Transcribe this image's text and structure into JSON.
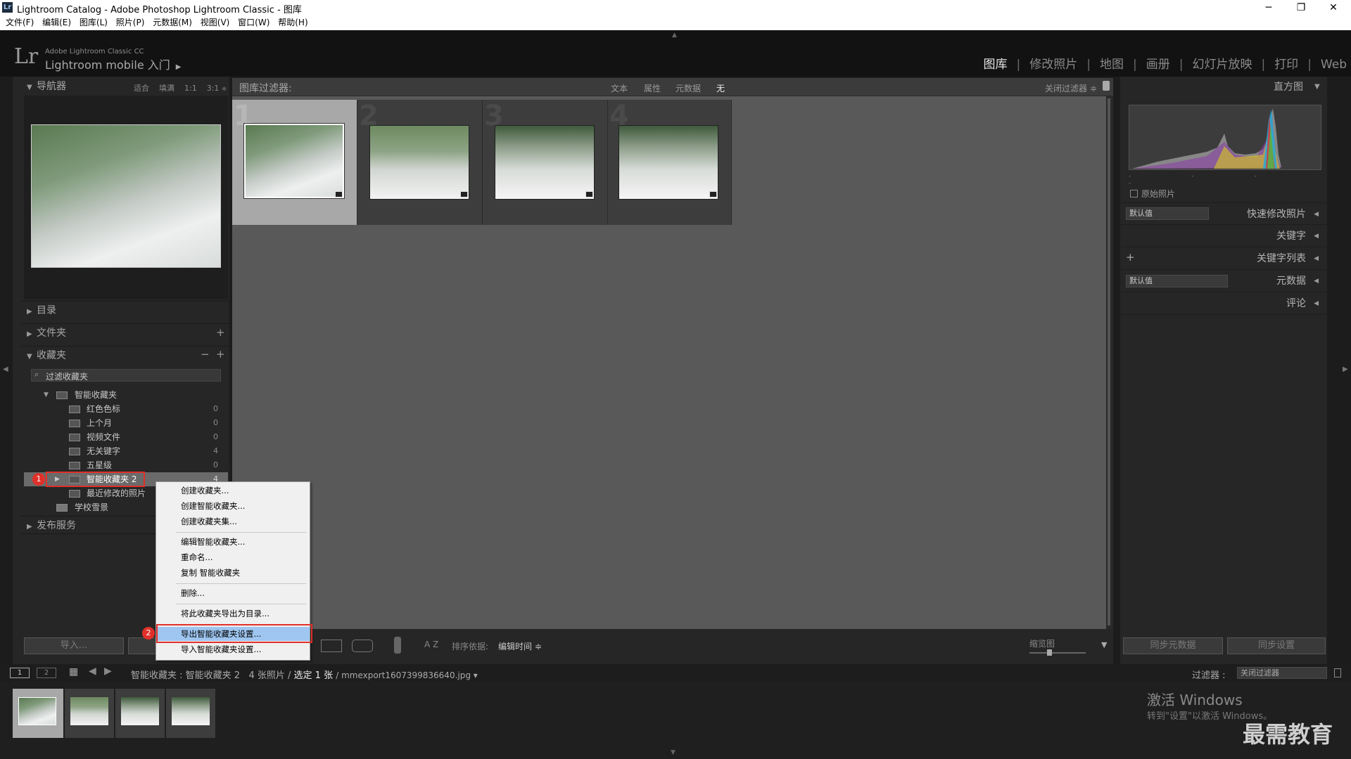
{
  "window": {
    "title": "Lightroom Catalog - Adobe Photoshop Lightroom Classic - 图库",
    "app_badge": "Lr",
    "buttons": {
      "minimize": "─",
      "maximize": "❐",
      "close": "✕"
    }
  },
  "menubar": [
    "文件(F)",
    "编辑(E)",
    "图库(L)",
    "照片(P)",
    "元数据(M)",
    "视图(V)",
    "窗口(W)",
    "帮助(H)"
  ],
  "brand": {
    "logo": "Lr",
    "line1": "Adobe Lightroom Classic CC",
    "line2": "Lightroom mobile 入门",
    "line2_arrow": "▶"
  },
  "modules": [
    {
      "label": "图库",
      "active": true
    },
    {
      "label": "修改照片",
      "active": false
    },
    {
      "label": "地图",
      "active": false
    },
    {
      "label": "画册",
      "active": false
    },
    {
      "label": "幻灯片放映",
      "active": false
    },
    {
      "label": "打印",
      "active": false
    },
    {
      "label": "Web",
      "active": false
    }
  ],
  "navigator": {
    "title": "导航器",
    "zoom_options": [
      "适合",
      "填满",
      "1:1",
      "3:1"
    ]
  },
  "left_panels": {
    "catalog": "目录",
    "folders": "文件夹",
    "folders_add": "+",
    "collections": "收藏夹",
    "collections_minus": "−",
    "collections_plus": "+",
    "filter_placeholder": "过滤收藏夹",
    "publish": "发布服务"
  },
  "collections": {
    "smart_set": "智能收藏夹",
    "items": [
      {
        "label": "红色色标",
        "count": "0"
      },
      {
        "label": "上个月",
        "count": "0"
      },
      {
        "label": "视频文件",
        "count": "0"
      },
      {
        "label": "无关键字",
        "count": "4"
      },
      {
        "label": "五星级",
        "count": "0"
      },
      {
        "label": "智能收藏夹 2",
        "count": "4"
      },
      {
        "label": "最近修改的照片",
        "count": ""
      }
    ],
    "school": "学校雪景"
  },
  "filterbar": {
    "label": "图库过滤器:",
    "tabs": [
      "文本",
      "属性",
      "元数据",
      "无"
    ],
    "close": "关闭过滤器 ≑"
  },
  "grid_cells": [
    "1",
    "2",
    "3",
    "4"
  ],
  "toolbar": {
    "import": "导入...",
    "sort_label": "排序依据:",
    "sort_value": "编辑时间 ≑",
    "zoom_label": "缩览图",
    "az": "A Z"
  },
  "right_panels": {
    "histogram": "直方图",
    "original": "原始照片",
    "quick_develop": "快速修改照片",
    "keywording": "关键字",
    "keyword_list": "关键字列表",
    "keyword_add": "+",
    "metadata": "元数据",
    "comments": "评论",
    "default_value": "默认值",
    "sync_metadata": "同步元数据",
    "sync_settings": "同步设置"
  },
  "context_menu": [
    "创建收藏夹...",
    "创建智能收藏夹...",
    "创建收藏夹集...",
    "编辑智能收藏夹...",
    "重命名...",
    "复制 智能收藏夹",
    "删除...",
    "将此收藏夹导出为目录...",
    "导出智能收藏夹设置...",
    "导入智能收藏夹设置..."
  ],
  "callouts": [
    "1",
    "2"
  ],
  "statusbar": {
    "page1": "1",
    "page2": "2",
    "source": "智能收藏夹 : 智能收藏夹 2",
    "count": "4 张照片 /",
    "selected": "选定 1 张",
    "filename": "/ mmexport1607399836640.jpg ▾",
    "filter_label": "过滤器 :",
    "filter_value": "关闭过滤器"
  },
  "watermark": {
    "line1": "激活 Windows",
    "line2": "转到\"设置\"以激活 Windows。",
    "brand": "最需教育"
  }
}
